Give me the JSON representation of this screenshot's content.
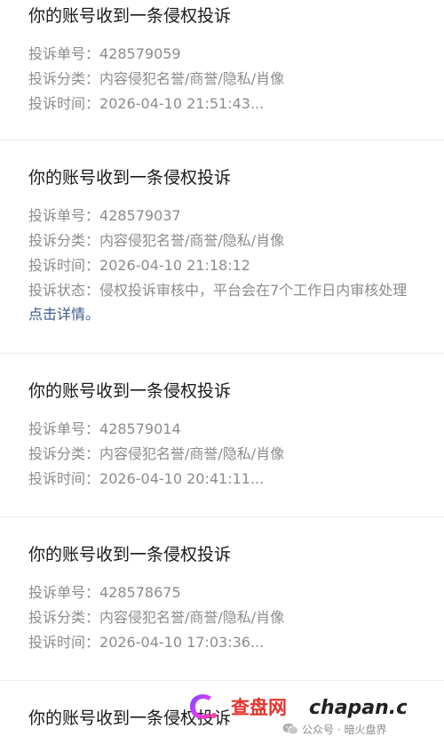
{
  "notices": [
    {
      "title": "你的账号收到一条侵权投诉",
      "rows": [
        {
          "label": "投诉单号：",
          "value": "428579059"
        },
        {
          "label": "投诉分类：",
          "value": "内容侵犯名誉/商誉/隐私/肖像"
        },
        {
          "label": "投诉时间：",
          "value": "2026-04-10 21:51:43..."
        }
      ]
    },
    {
      "title": "你的账号收到一条侵权投诉",
      "rows": [
        {
          "label": "投诉单号：",
          "value": "428579037"
        },
        {
          "label": "投诉分类：",
          "value": "内容侵犯名誉/商誉/隐私/肖像"
        },
        {
          "label": "投诉时间：",
          "value": "2026-04-10 21:18:12"
        },
        {
          "label": "投诉状态：",
          "value": "侵权投诉审核中，平台会在7个工作日内审核处理"
        }
      ],
      "link": "点击详情。"
    },
    {
      "title": "你的账号收到一条侵权投诉",
      "rows": [
        {
          "label": "投诉单号：",
          "value": "428579014"
        },
        {
          "label": "投诉分类：",
          "value": "内容侵犯名誉/商誉/隐私/肖像"
        },
        {
          "label": "投诉时间：",
          "value": "2026-04-10 20:41:11..."
        }
      ]
    },
    {
      "title": "你的账号收到一条侵权投诉",
      "rows": [
        {
          "label": "投诉单号：",
          "value": "428578675"
        },
        {
          "label": "投诉分类：",
          "value": "内容侵犯名誉/商誉/隐私/肖像"
        },
        {
          "label": "投诉时间：",
          "value": "2026-04-10 17:03:36..."
        }
      ]
    },
    {
      "title": "你的账号收到一条侵权投诉"
    }
  ],
  "watermark": {
    "brand_cn": "查盘网",
    "brand_en": "chapan.cc",
    "account": "公众号 · 暗火盘界"
  },
  "colors": {
    "title": "#1a1a1a",
    "meta": "#8c8c8c",
    "link": "#3c5a8c",
    "brand_red": "#e8322d",
    "brand_dark": "#222222"
  },
  "icons": {
    "watermark_logo": "brand-c-logo-icon",
    "account": "wechat-icon"
  }
}
